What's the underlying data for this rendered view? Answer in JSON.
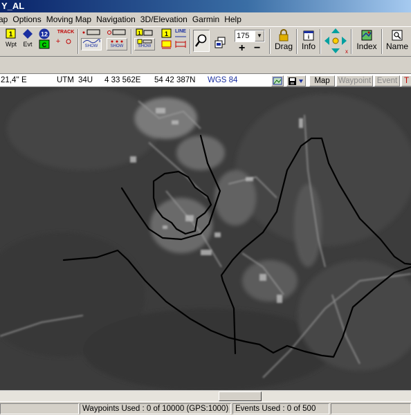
{
  "window": {
    "title": "Y_AL"
  },
  "menu": [
    "ap",
    "Options",
    "Moving Map",
    "Navigation",
    "3D/Elevation",
    "Garmin",
    "Help"
  ],
  "toolbar": {
    "wpt_label": "Wpt",
    "evt_label": "Evt",
    "badge_12": "12",
    "badge_c": "C",
    "track_label": "TRACK",
    "show_label": "SHOW",
    "zoom_value": "175",
    "zoom_in": "+",
    "zoom_out": "−",
    "drag_label": "Drag",
    "info_label": "Info",
    "index_label": "Index",
    "name_label": "Name",
    "line_label": "LINE"
  },
  "coords": {
    "lon": "21,4'' E",
    "zone_label": "UTM",
    "zone": "34U",
    "easting": "4 33 562E",
    "northing": "54 42 387N",
    "datum": "WGS 84"
  },
  "modes": {
    "map": "Map",
    "waypoint": "Waypoint",
    "event": "Event",
    "track": "T"
  },
  "status": {
    "waypoints": "Waypoints Used : 0 of 10000  (GPS:1000)",
    "events": "Events Used : 0 of 500"
  },
  "colors": {
    "titlebar": "#0a246a",
    "accent_blue": "#1a2fa0",
    "disabled_text": "#8a8a8a",
    "track_red": "#c00000",
    "map_line": "#000000"
  }
}
